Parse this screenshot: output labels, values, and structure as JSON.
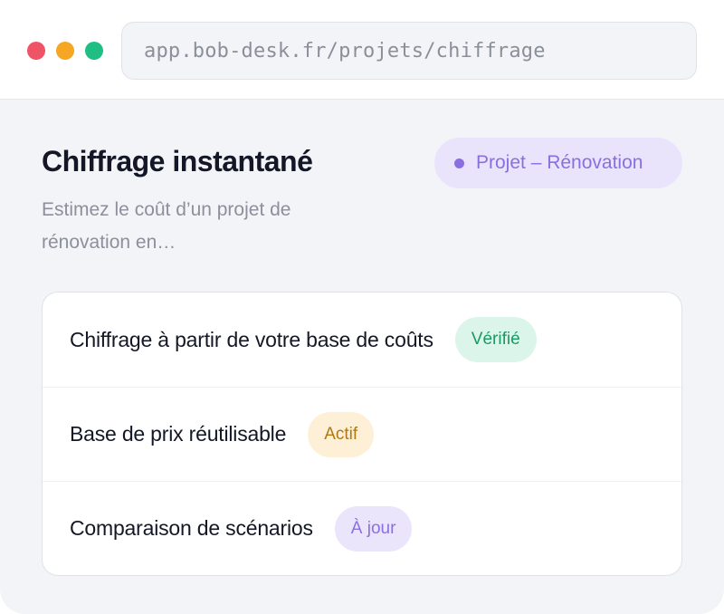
{
  "browser": {
    "url": "app.bob-desk.fr/projets/chiffrage"
  },
  "header": {
    "title": "Chiffrage instantané",
    "subtitle": "Estimez le coût d’un projet de rénovation en…",
    "project_badge": "Projet – Rénovation"
  },
  "features": [
    {
      "label": "Chiffrage à partir de votre base de coûts",
      "tag": "Vérifié",
      "tag_color": "#1a9a63"
    },
    {
      "label": "Base de prix réutilisable",
      "tag": "Actif",
      "tag_color": "#b07812"
    },
    {
      "label": "Comparaison de scénarios",
      "tag": "À jour",
      "tag_color": "#8a6fe0"
    }
  ],
  "colors": {
    "close": "#ef5466",
    "minimize": "#f5a623",
    "maximize": "#1fbf83",
    "accent": "#8a6fe0"
  }
}
